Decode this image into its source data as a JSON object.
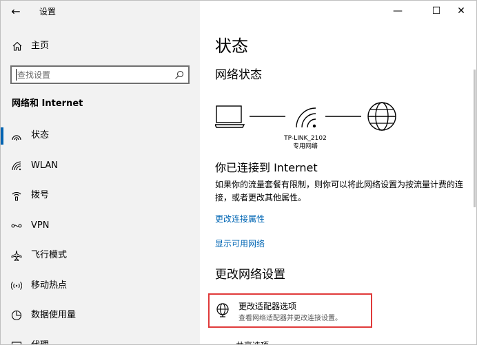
{
  "window": {
    "title": "设置",
    "back_icon": "arrow-left-icon",
    "controls": {
      "minimize": "—",
      "maximize": "☐",
      "close": "✕"
    }
  },
  "sidebar": {
    "home_label": "主页",
    "search_placeholder": "查找设置",
    "section_title": "网络和 Internet",
    "items": [
      {
        "label": "状态",
        "icon": "status-icon",
        "active": true
      },
      {
        "label": "WLAN",
        "icon": "wifi-icon",
        "active": false
      },
      {
        "label": "拨号",
        "icon": "dialup-icon",
        "active": false
      },
      {
        "label": "VPN",
        "icon": "vpn-icon",
        "active": false
      },
      {
        "label": "飞行模式",
        "icon": "airplane-icon",
        "active": false
      },
      {
        "label": "移动热点",
        "icon": "hotspot-icon",
        "active": false
      },
      {
        "label": "数据使用量",
        "icon": "data-usage-icon",
        "active": false
      },
      {
        "label": "代理",
        "icon": "proxy-icon",
        "active": false
      }
    ]
  },
  "main": {
    "page_title": "状态",
    "network_status_heading": "网络状态",
    "network_name": "TP-LINK_2102",
    "network_type": "专用网络",
    "connected_heading": "你已连接到 Internet",
    "description": "如果你的流量套餐有限制，则你可以将此网络设置为按流量计费的连接，或者更改其他属性。",
    "links": {
      "change_connection_properties": "更改连接属性",
      "show_available_networks": "显示可用网络"
    },
    "change_settings_heading": "更改网络设置",
    "adapter_option": {
      "title": "更改适配器选项",
      "subtitle": "查看网络适配器并更改连接设置。"
    },
    "sharing_option": {
      "title": "共享选项"
    }
  },
  "colors": {
    "sidebar_bg": "#f2f2f2",
    "accent": "#0063b1",
    "link": "#0066b4",
    "highlight_border": "#e03a3a"
  }
}
